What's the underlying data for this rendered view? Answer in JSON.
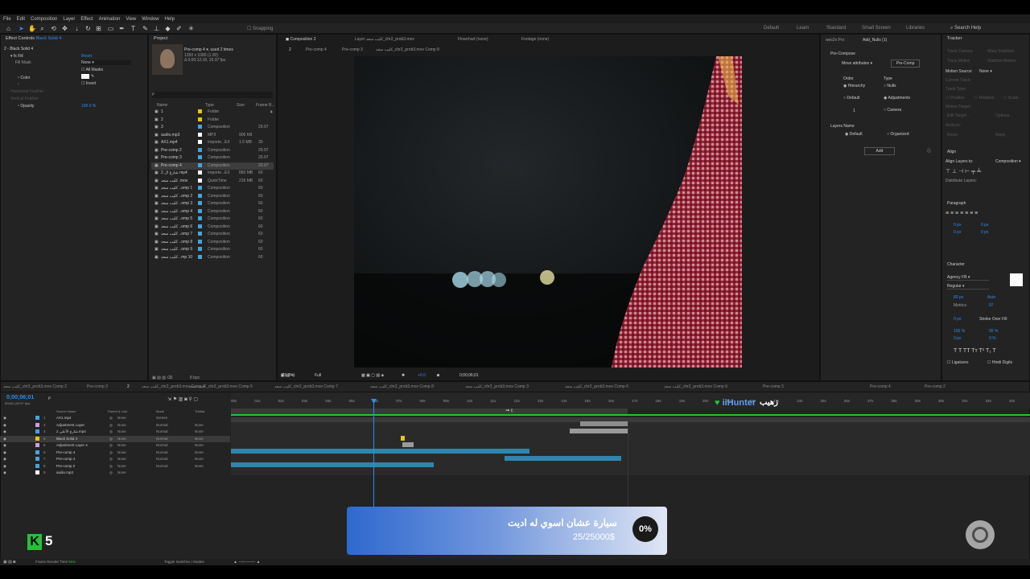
{
  "menu": [
    "File",
    "Edit",
    "Composition",
    "Layer",
    "Effect",
    "Animation",
    "View",
    "Window",
    "Help"
  ],
  "toolbar": {
    "snapping": "Snapping",
    "workspaces": [
      "Default",
      "Learn",
      "Standard",
      "Small Screen",
      "Libraries"
    ],
    "search_help": "Search Help"
  },
  "effect_controls": {
    "title": "Effect Controls",
    "layer": "Black Solid 4",
    "path": "2 - Black Solid 4",
    "fill_label": "Fill",
    "reset": "Reset",
    "fill_mask_label": "Fill Mask",
    "fill_mask_value": "None",
    "all_masks": "All Masks",
    "color_label": "Color",
    "invert": "Invert",
    "h_feather": "Horizontal Feather",
    "v_feather": "Vertical Feather",
    "opacity_label": "Opacity",
    "opacity_value": "100.0 %"
  },
  "project": {
    "title": "Project",
    "comp_name": "Pre-comp 4",
    "used": ", used 2 times",
    "dims": "1350 x 1080 (1.00)",
    "dur": "Δ 0;00;12;18, 29.97 fps",
    "search": "ρ",
    "headers": {
      "name": "Name",
      "type": "Type",
      "size": "Size",
      "fps": "Frame R..."
    },
    "items": [
      {
        "name": "1",
        "type": "Folder",
        "size": "",
        "fps": "",
        "color": "#e8c31a"
      },
      {
        "name": "2",
        "type": "Folder",
        "size": "",
        "fps": "",
        "color": "#e8c31a"
      },
      {
        "name": "3",
        "type": "Composition",
        "size": "",
        "fps": "29.97",
        "color": "#46a4d9"
      },
      {
        "name": "audio.mp3",
        "type": "MP3",
        "size": "906 KB",
        "fps": "",
        "color": "#ffffff"
      },
      {
        "name": "AX1.mp4",
        "type": "Importe...EX",
        "size": "1.5 MB",
        "fps": "30",
        "color": "#ffffff"
      },
      {
        "name": "Pre-comp 2",
        "type": "Composition",
        "size": "",
        "fps": "29.97",
        "color": "#46a4d9"
      },
      {
        "name": "Pre-comp 3",
        "type": "Composition",
        "size": "",
        "fps": "29.97",
        "color": "#46a4d9"
      },
      {
        "name": "Pre-comp 4",
        "type": "Composition",
        "size": "",
        "fps": "29.97",
        "color": "#46a4d9"
      },
      {
        "name": "شارع ال 2 mp4",
        "type": "Importe...EX",
        "size": "860 MB",
        "fps": "60",
        "color": "#ffffff"
      },
      {
        "name": "كليب سعد .mov",
        "type": "QuickTime",
        "size": "216 MB",
        "fps": "60",
        "color": "#ffffff"
      },
      {
        "name": "كليب سعد ..omp 1",
        "type": "Composition",
        "size": "",
        "fps": "60",
        "color": "#46a4d9"
      },
      {
        "name": "كليب سعد ..omp 2",
        "type": "Composition",
        "size": "",
        "fps": "60",
        "color": "#46a4d9"
      },
      {
        "name": "كليب سعد ..omp 3",
        "type": "Composition",
        "size": "",
        "fps": "60",
        "color": "#46a4d9"
      },
      {
        "name": "كليب سعد ..omp 4",
        "type": "Composition",
        "size": "",
        "fps": "60",
        "color": "#46a4d9"
      },
      {
        "name": "كليب سعد ..omp 5",
        "type": "Composition",
        "size": "",
        "fps": "60",
        "color": "#46a4d9"
      },
      {
        "name": "كليب سعد ..omp 6",
        "type": "Composition",
        "size": "",
        "fps": "60",
        "color": "#46a4d9"
      },
      {
        "name": "كليب سعد ..omp 7",
        "type": "Composition",
        "size": "",
        "fps": "60",
        "color": "#46a4d9"
      },
      {
        "name": "كليب سعد ..omp 8",
        "type": "Composition",
        "size": "",
        "fps": "60",
        "color": "#46a4d9"
      },
      {
        "name": "كليب سعد ..omp 9",
        "type": "Composition",
        "size": "",
        "fps": "60",
        "color": "#46a4d9"
      },
      {
        "name": "كليب سعد ..mp 10",
        "type": "Composition",
        "size": "",
        "fps": "60",
        "color": "#46a4d9"
      }
    ],
    "footer": "8 bpc"
  },
  "viewer": {
    "tabs": [
      "Composition 2",
      "Layer كليب سعد_chr2_prob3.mov",
      "Flowchart (none)",
      "Footage (none)"
    ],
    "breadcrumbs": [
      "2",
      "Pre-comp 4",
      "Pre-comp 3",
      "كليب سعد_chr2_prob3.mov Comp 8"
    ],
    "zoom": "(71.3%)",
    "quality": "Full",
    "time": "0;00;06;01",
    "offset": "+0.0"
  },
  "plugin": {
    "tabs": [
      "wes2x Pro",
      "Add_Nulls (1)"
    ],
    "precompose": "Pre-Compose",
    "move_attr": "Move attributes",
    "precomp_btn": "Pre-Comp",
    "order": "Order",
    "type": "Type",
    "hierarchy": "Hierarchy",
    "default": "Default",
    "nulls": "Nulls",
    "adjustments": "Adjustments",
    "camera": "Camera",
    "layers_name": "Layers Name",
    "default2": "Default",
    "organized": "Organized",
    "add": "Add",
    "count": "1"
  },
  "tracker": {
    "title": "Tracker",
    "items": [
      "Track Camera",
      "Warp Stabilizer",
      "Track Motion",
      "Stabilize Motion"
    ],
    "motion_source_label": "Motion Source:",
    "motion_source": "None",
    "current_track": "Current Track:",
    "track_type": "Track Type:",
    "position": "Position",
    "rotation": "Rotation",
    "scale": "Scale",
    "motion_target": "Motion Target:",
    "edit_target": "Edit Target...",
    "options": "Options...",
    "analyze": "Analyze:",
    "reset": "Reset",
    "apply": "Apply"
  },
  "align": {
    "title": "Align",
    "align_to_label": "Align Layers to:",
    "align_to": "Composition",
    "distribute": "Distribute Layers:"
  },
  "paragraph": {
    "title": "Paragraph",
    "v1": "0 px",
    "v2": "0 px",
    "v3": "0 px",
    "v4": "0 px",
    "v5": "0 px"
  },
  "character": {
    "title": "Character",
    "font": "Agency FB",
    "style": "Regular",
    "size": "80 px",
    "leading": "Auto",
    "kerning": "Metrics",
    "tracking": "97",
    "stroke": "0 px",
    "stroke_type": "Stroke Over Fill",
    "vscale": "100 %",
    "hscale": "95 %",
    "baseline": "0 px",
    "tsume": "0 %",
    "ligatures": "Ligatures",
    "hindi": "Hindi Digits"
  },
  "timeline": {
    "tabs": [
      "كليب سعد_chr3_prob3.mov Comp 2",
      "Pre-comp 3",
      "2",
      "كليب سعد_chr2_prob3.mov Comp 4",
      "كليب سعد_chr2_prob3.mov Comp 5",
      "كليب سعد_chr2_prob3.mov Comp 7",
      "كليب سعد_chr2_prob3.mov Comp 8",
      "كليب سعد_chr2_prob3.mov Comp 3",
      "كليب سعد_chr2_prob3.mov Comp 6",
      "كليب سعد_chr2_prob3.mov Comp 9",
      "Pre-comp 3",
      "Pre-comp 4",
      "Pre-comp 2"
    ],
    "timecode": "0;00;06;01",
    "fps": "00181 (29.97 fps)",
    "search": "ρ",
    "headers": {
      "source": "Source Name",
      "parent": "Parent & Link",
      "mode": "Mode",
      "trkmat": "TrkMat"
    },
    "ruler": [
      "00s",
      "01s",
      "02s",
      "03s",
      "04s",
      "05s",
      "06s",
      "07s",
      "08s",
      "09s",
      "10s",
      "11s",
      "12s",
      "13s",
      "14s",
      "15s",
      "16s",
      "17s",
      "18s",
      "19s",
      "20s",
      "21s",
      "22s",
      "23s",
      "24s",
      "25s",
      "26s",
      "27s",
      "28s",
      "29s",
      "30s",
      "31s",
      "32s",
      "33s"
    ],
    "layers": [
      {
        "num": "1",
        "name": "AX1.mp4",
        "parent": "None",
        "mode": "Screen",
        "trk": "",
        "color": "#46a4d9"
      },
      {
        "num": "2",
        "name": "Adjustment Layer",
        "parent": "None",
        "mode": "Normal",
        "trk": "None",
        "color": "#c9a0dc"
      },
      {
        "num": "3",
        "name": "شارع الأعلى 2.mp4",
        "parent": "None",
        "mode": "Normal",
        "trk": "None",
        "color": "#46a4d9"
      },
      {
        "num": "4",
        "name": "Black Solid 4",
        "parent": "None",
        "mode": "Normal",
        "trk": "None",
        "color": "#e8c31a"
      },
      {
        "num": "5",
        "name": "Adjustment Layer 4",
        "parent": "None",
        "mode": "Normal",
        "trk": "None",
        "color": "#c9a0dc"
      },
      {
        "num": "6",
        "name": "Pre-comp 4",
        "parent": "None",
        "mode": "Normal",
        "trk": "None",
        "color": "#46a4d9"
      },
      {
        "num": "7",
        "name": "Pre-comp 4",
        "parent": "None",
        "mode": "Normal",
        "trk": "None",
        "color": "#46a4d9"
      },
      {
        "num": "8",
        "name": "Pre-comp 2",
        "parent": "None",
        "mode": "Normal",
        "trk": "None",
        "color": "#46a4d9"
      },
      {
        "num": "9",
        "name": "audio.mp3",
        "parent": "None",
        "mode": "",
        "trk": "",
        "color": "#ffffff"
      }
    ],
    "marker_text": "ع هه",
    "footer_render": "Frame Render Time",
    "render_value": "5ms",
    "toggle": "Toggle Switches / Modes"
  },
  "overlay": {
    "hunter": "iiHunter",
    "hunter_ar": "زهيب",
    "channel_badge": "K",
    "channel_num": "5",
    "donation_title": "سيارة عشان اسوي له اديت",
    "donation_amount": "25/25000$",
    "donation_pct": "0%"
  },
  "colors": {
    "accent": "#2d8ceb",
    "panel": "#232323",
    "green": "#27c03a"
  }
}
